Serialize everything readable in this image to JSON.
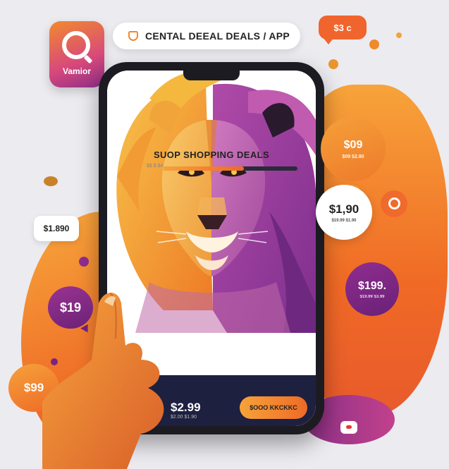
{
  "app_icon": {
    "name": "Vamior"
  },
  "header": {
    "title": "CENTAL DEEAL DEALS / APP"
  },
  "price_bubbles": {
    "top_right": "$3 c",
    "right_orange": "$09",
    "right_orange_sub": "$09  $2.80",
    "right_white": "$1,90",
    "right_white_sub": "$19.99 $1.90",
    "right_purple": "$199.",
    "right_purple_sub": "$19.99 $3.99",
    "left_white": "$1.890",
    "left_purple": "$19",
    "left_orange": "$99"
  },
  "phone": {
    "deals_title": "SUOP SHOPPING DEALS",
    "progress_label": "$$ $ $4",
    "progress": 0.6,
    "stars": "$·$·$",
    "price": "$2.99",
    "price_sub": "$2.00 $1.90",
    "cta_label": "$OOO KKCKKC"
  },
  "colors": {
    "orange": "#ee6a26",
    "purple": "#8f2d8f",
    "navy": "#1e2040"
  }
}
